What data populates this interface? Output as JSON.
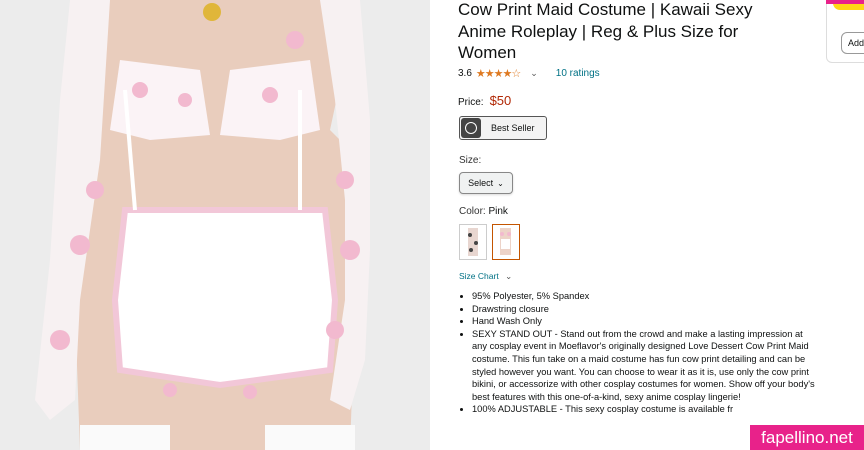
{
  "product": {
    "title": "Cow Print Maid Costume | Kawaii Sexy Anime Roleplay | Reg & Plus Size for Women",
    "rating_value": "3.6",
    "stars": "★★★★☆",
    "ratings_link": "10 ratings",
    "price_label": "Price:",
    "price": "$50",
    "badge": "Best Seller",
    "size_label": "Size:",
    "size_select": "Select",
    "color_label": "Color:",
    "color_value": "Pink",
    "size_chart": "Size Chart",
    "bullets": [
      "95% Polyester, 5% Spandex",
      "Drawstring closure",
      "Hand Wash Only",
      "SEXY STAND OUT - Stand out from the crowd and make a lasting impression at any cosplay event in Moeflavor's originally designed Love Dessert Cow Print Maid costume. This fun take on a maid costume has fun cow print detailing and can be styled however you want. You can choose to wear it as it is, use only the cow print bikini, or accessorize with other cosplay costumes for women. Show off your body's best features with this one-of-a-kind, sexy anime cosplay lingerie!",
      "100% ADJUSTABLE - This sexy cosplay costume is available fr"
    ]
  },
  "side_panel": {
    "add_label": "Add"
  },
  "watermark": "fapellino.net",
  "colors": {
    "price": "#b12704",
    "link": "#007185",
    "star": "#de7921",
    "watermark": "#e8228a",
    "cart_button": "#ffd814"
  },
  "icons": {
    "badge": "badge-logo-icon",
    "dropdown": "chevron-down-icon"
  }
}
